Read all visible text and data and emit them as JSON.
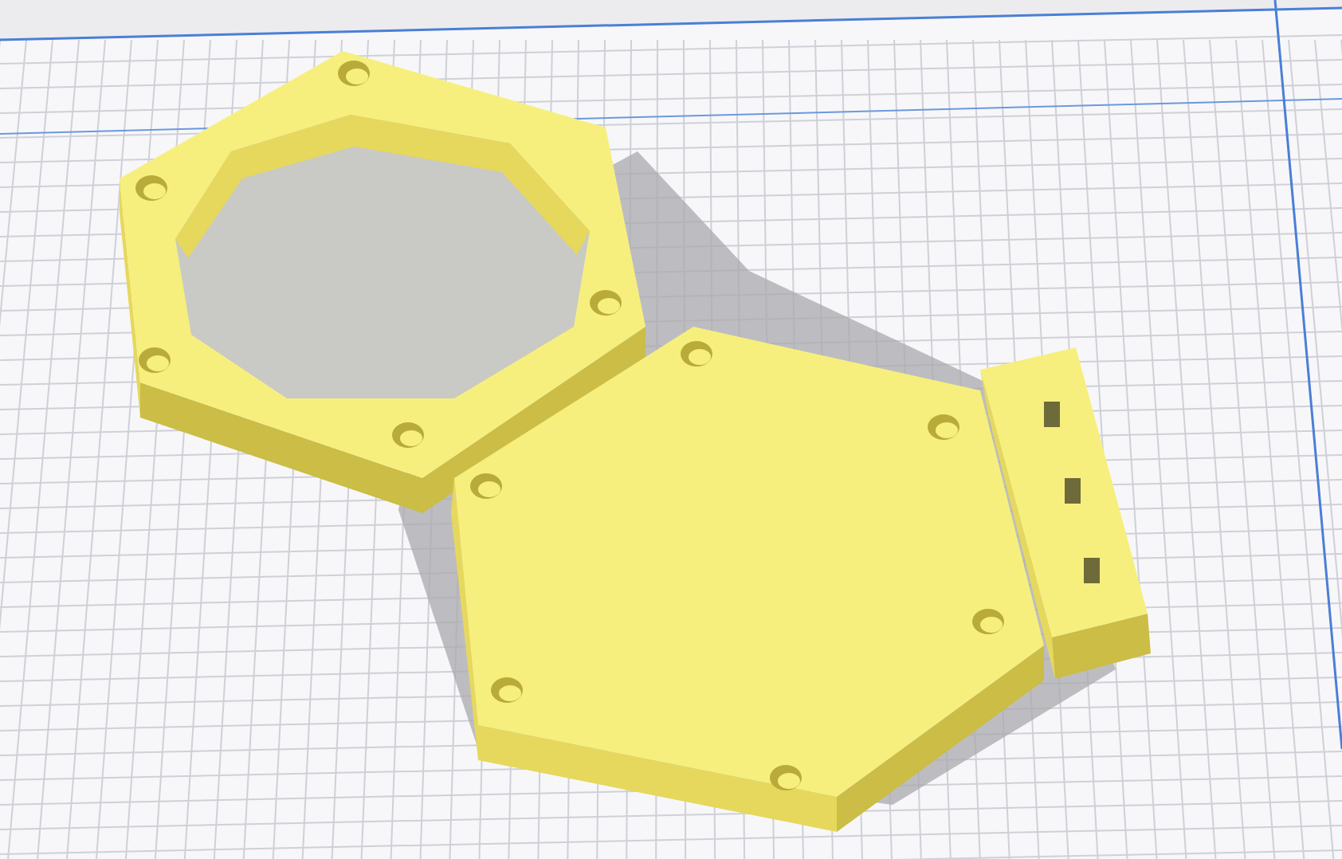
{
  "scene": {
    "objects": [
      {
        "kind": "hex-ring"
      },
      {
        "kind": "hex-plate"
      },
      {
        "kind": "connector-block"
      }
    ]
  }
}
